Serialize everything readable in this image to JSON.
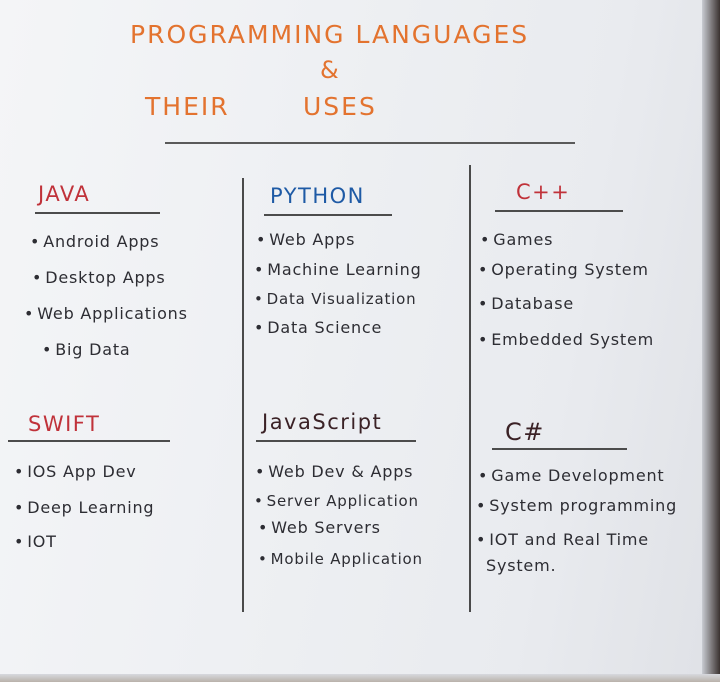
{
  "title": {
    "line1": "PROGRAMMING LANGUAGES",
    "line2": "&",
    "line3a": "THEIR",
    "line3b": "USES"
  },
  "sections": [
    {
      "name": "JAVA",
      "items": [
        "Android Apps",
        "Desktop Apps",
        "Web Applications",
        "Big Data"
      ]
    },
    {
      "name": "PYTHON",
      "items": [
        "Web Apps",
        "Machine Learning",
        "Data Visualization",
        "Data Science"
      ]
    },
    {
      "name": "C++",
      "items": [
        "Games",
        "Operating System",
        "Database",
        "Embedded System"
      ]
    },
    {
      "name": "SWIFT",
      "items": [
        "IOS App Dev",
        "Deep Learning",
        "IOT"
      ]
    },
    {
      "name": "JavaScript",
      "items": [
        "Web Dev & Apps",
        "Server Application",
        "Web Servers",
        "Mobile Application"
      ]
    },
    {
      "name": "C#",
      "items": [
        "Game Development",
        "System programming",
        "IOT and Real Time",
        "System."
      ]
    }
  ],
  "colors": {
    "title": "#e3732f",
    "heading_red": "#c0323a",
    "heading_blue": "#1e5aa5",
    "heading_dark": "#3b2226",
    "ink": "#2d2d33"
  }
}
